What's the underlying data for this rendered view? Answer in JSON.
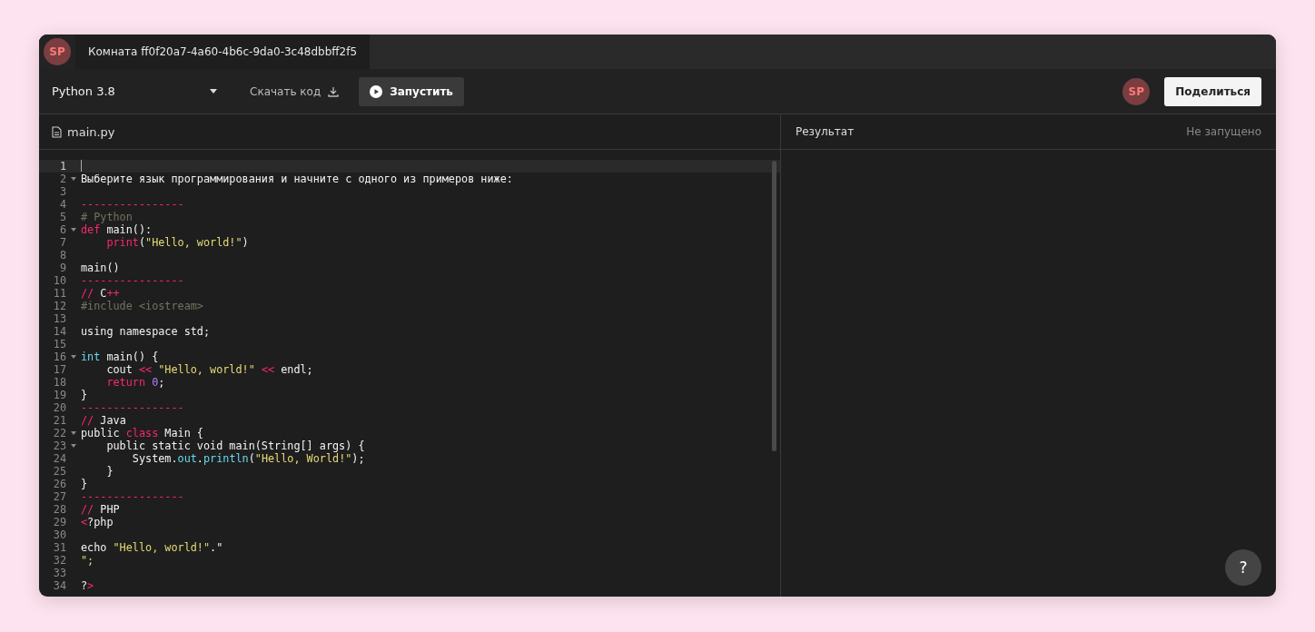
{
  "tabs": [
    {
      "avatar": "SP",
      "label": "Комната ff0f20a7-4a60-4b6c-9da0-3c48dbbff2f5",
      "selected": true
    }
  ],
  "toolbar": {
    "language": "Python 3.8",
    "download": "Скачать код",
    "run": "Запустить",
    "user_avatar": "SP",
    "share": "Поделиться"
  },
  "editor": {
    "file": "main.py",
    "lines": [
      {
        "number": "1",
        "fold": false,
        "active": true
      },
      {
        "number": "2",
        "fold": true,
        "active": false,
        "tokens": [
          {
            "text": "Выберите язык программирования и начните с одного из примеров ниже:",
            "kind": "plain"
          }
        ]
      },
      {
        "number": "3",
        "fold": false,
        "active": false
      },
      {
        "number": "4",
        "fold": false,
        "active": false,
        "tokens": [
          {
            "text": "----------------",
            "kind": "keyword"
          }
        ]
      },
      {
        "number": "5",
        "fold": false,
        "active": false,
        "tokens": [
          {
            "text": "# Python",
            "kind": "comment"
          }
        ]
      },
      {
        "number": "6",
        "fold": true,
        "active": false,
        "tokens": [
          {
            "text": "def",
            "kind": "keyword"
          },
          {
            "text": " main():",
            "kind": "plain"
          }
        ]
      },
      {
        "number": "7",
        "fold": false,
        "active": false,
        "tokens": [
          {
            "text": "    print",
            "kind": "keyword"
          },
          {
            "text": "(",
            "kind": "plain"
          },
          {
            "text": "\"Hello, world!\"",
            "kind": "string"
          },
          {
            "text": ")",
            "kind": "plain"
          }
        ]
      },
      {
        "number": "8",
        "fold": false,
        "active": false
      },
      {
        "number": "9",
        "fold": false,
        "active": false,
        "tokens": [
          {
            "text": "main()",
            "kind": "plain"
          }
        ]
      },
      {
        "number": "10",
        "fold": false,
        "active": false,
        "tokens": [
          {
            "text": "----------------",
            "kind": "keyword"
          }
        ]
      },
      {
        "number": "11",
        "fold": false,
        "active": false,
        "tokens": [
          {
            "text": "//",
            "kind": "keyword"
          },
          {
            "text": " C",
            "kind": "plain"
          },
          {
            "text": "++",
            "kind": "keyword"
          }
        ]
      },
      {
        "number": "12",
        "fold": false,
        "active": false,
        "tokens": [
          {
            "text": "#include <iostream>",
            "kind": "comment"
          }
        ]
      },
      {
        "number": "13",
        "fold": false,
        "active": false
      },
      {
        "number": "14",
        "fold": false,
        "active": false,
        "tokens": [
          {
            "text": "using namespace std;",
            "kind": "plain"
          }
        ]
      },
      {
        "number": "15",
        "fold": false,
        "active": false
      },
      {
        "number": "16",
        "fold": true,
        "active": false,
        "tokens": [
          {
            "text": "int",
            "kind": "type"
          },
          {
            "text": " main() {",
            "kind": "plain"
          }
        ]
      },
      {
        "number": "17",
        "fold": false,
        "active": false,
        "tokens": [
          {
            "text": "    cout ",
            "kind": "plain"
          },
          {
            "text": "<<",
            "kind": "keyword"
          },
          {
            "text": " \"Hello, world!\"",
            "kind": "string"
          },
          {
            "text": " <<",
            "kind": "keyword"
          },
          {
            "text": " endl;",
            "kind": "plain"
          }
        ]
      },
      {
        "number": "18",
        "fold": false,
        "active": false,
        "tokens": [
          {
            "text": "    return",
            "kind": "keyword"
          },
          {
            "text": " 0",
            "kind": "number"
          },
          {
            "text": ";",
            "kind": "plain"
          }
        ]
      },
      {
        "number": "19",
        "fold": false,
        "active": false,
        "tokens": [
          {
            "text": "}",
            "kind": "plain"
          }
        ]
      },
      {
        "number": "20",
        "fold": false,
        "active": false,
        "tokens": [
          {
            "text": "----------------",
            "kind": "keyword"
          }
        ]
      },
      {
        "number": "21",
        "fold": false,
        "active": false,
        "tokens": [
          {
            "text": "//",
            "kind": "keyword"
          },
          {
            "text": " Java",
            "kind": "plain"
          }
        ]
      },
      {
        "number": "22",
        "fold": true,
        "active": false,
        "tokens": [
          {
            "text": "public ",
            "kind": "plain"
          },
          {
            "text": "class",
            "kind": "keyword"
          },
          {
            "text": " Main {",
            "kind": "plain"
          }
        ]
      },
      {
        "number": "23",
        "fold": true,
        "active": false,
        "tokens": [
          {
            "text": "    public static void main(String[] args) {",
            "kind": "plain"
          }
        ]
      },
      {
        "number": "24",
        "fold": false,
        "active": false,
        "tokens": [
          {
            "text": "        System.",
            "kind": "plain"
          },
          {
            "text": "out",
            "kind": "type"
          },
          {
            "text": ".",
            "kind": "plain"
          },
          {
            "text": "println",
            "kind": "type"
          },
          {
            "text": "(",
            "kind": "plain"
          },
          {
            "text": "\"Hello, World!\"",
            "kind": "string"
          },
          {
            "text": ");",
            "kind": "plain"
          }
        ]
      },
      {
        "number": "25",
        "fold": false,
        "active": false,
        "tokens": [
          {
            "text": "    }",
            "kind": "plain"
          }
        ]
      },
      {
        "number": "26",
        "fold": false,
        "active": false,
        "tokens": [
          {
            "text": "}",
            "kind": "plain"
          }
        ]
      },
      {
        "number": "27",
        "fold": false,
        "active": false,
        "tokens": [
          {
            "text": "----------------",
            "kind": "keyword"
          }
        ]
      },
      {
        "number": "28",
        "fold": false,
        "active": false,
        "tokens": [
          {
            "text": "//",
            "kind": "keyword"
          },
          {
            "text": " PHP",
            "kind": "plain"
          }
        ]
      },
      {
        "number": "29",
        "fold": false,
        "active": false,
        "tokens": [
          {
            "text": "<",
            "kind": "keyword"
          },
          {
            "text": "?php",
            "kind": "plain"
          }
        ]
      },
      {
        "number": "30",
        "fold": false,
        "active": false
      },
      {
        "number": "31",
        "fold": false,
        "active": false,
        "tokens": [
          {
            "text": "echo ",
            "kind": "plain"
          },
          {
            "text": "\"Hello, world!\"",
            "kind": "string"
          },
          {
            "text": ".\"",
            "kind": "plain"
          }
        ]
      },
      {
        "number": "32",
        "fold": false,
        "active": false,
        "tokens": [
          {
            "text": "\";",
            "kind": "string"
          }
        ]
      },
      {
        "number": "33",
        "fold": false,
        "active": false
      },
      {
        "number": "34",
        "fold": false,
        "active": false,
        "tokens": [
          {
            "text": "?",
            "kind": "plain"
          },
          {
            "text": ">",
            "kind": "keyword"
          }
        ]
      }
    ]
  },
  "result": {
    "title": "Результат",
    "status": "Не запущено"
  },
  "help": "?"
}
